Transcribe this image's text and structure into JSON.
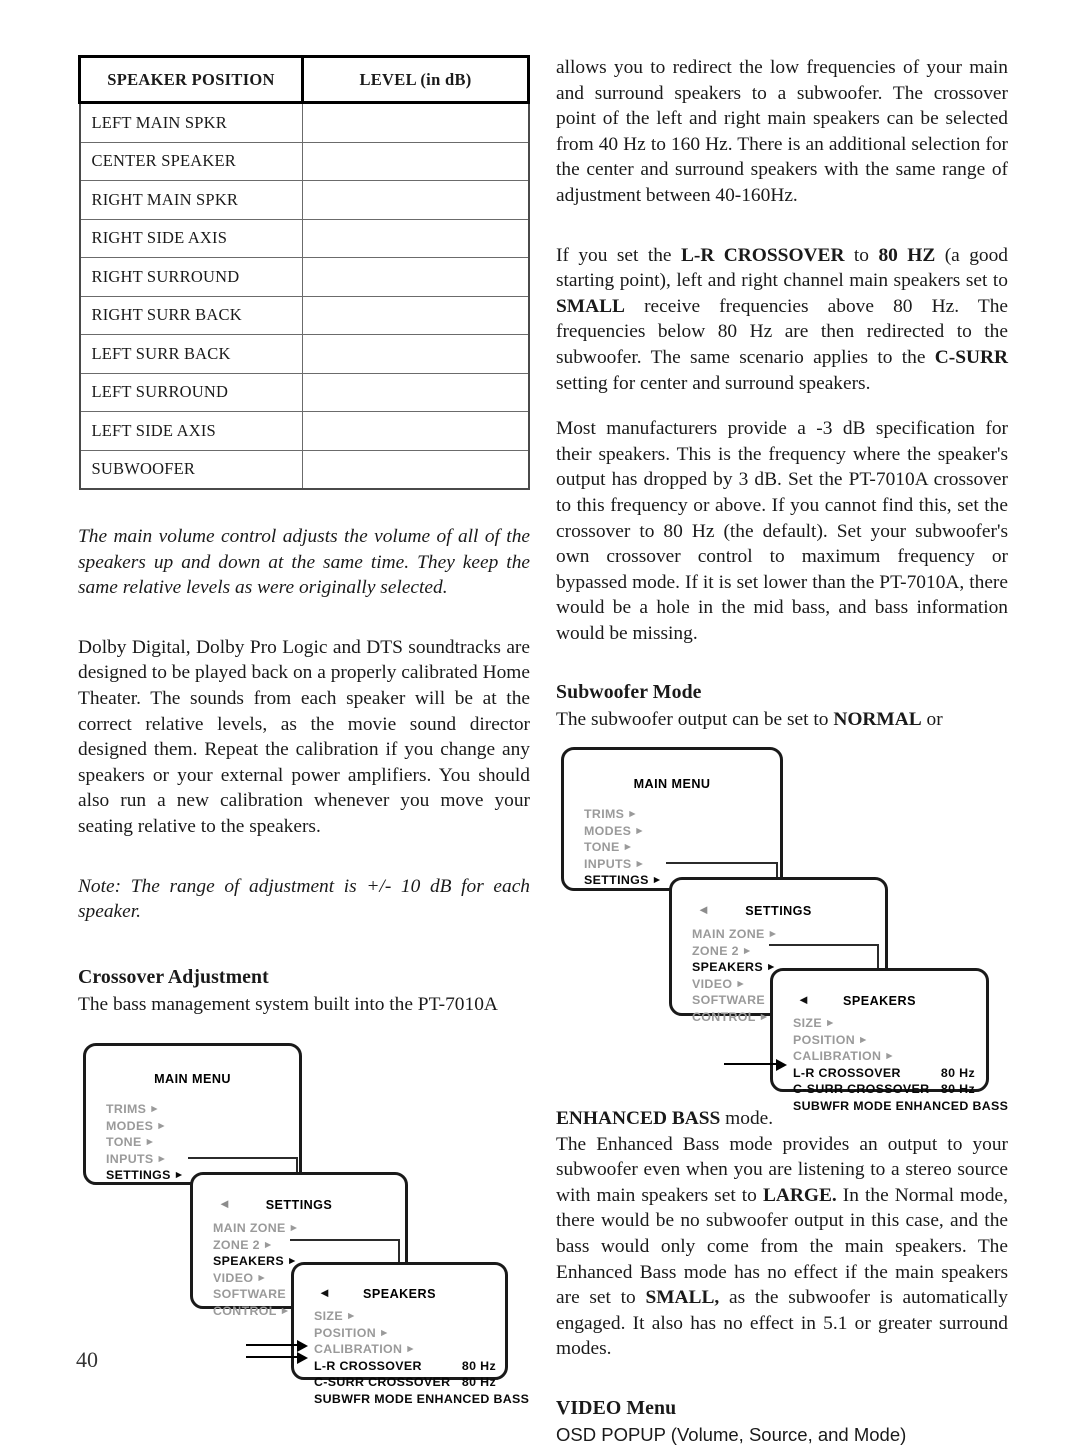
{
  "page": {
    "number": "40"
  },
  "table": {
    "headers": [
      "SPEAKER POSITION",
      "LEVEL (in dB)"
    ],
    "rows": [
      "LEFT MAIN SPKR",
      "CENTER SPEAKER",
      "RIGHT MAIN SPKR",
      "RIGHT SIDE AXIS",
      "RIGHT SURROUND",
      "RIGHT SURR BACK",
      "LEFT SURR BACK",
      "LEFT SURROUND",
      "LEFT SIDE AXIS",
      "SUBWOOFER"
    ],
    "values": [
      "",
      "",
      "",
      "",
      "",
      "",
      "",
      "",
      "",
      ""
    ]
  },
  "left_column": {
    "note_volume": "The main volume control adjusts the volume of all of the speakers up and down at the same time. They keep the same relative levels as were originally selected.",
    "calibration_paragraph": "Dolby Digital, Dolby Pro Logic and DTS soundtracks are designed to be played back on a properly calibrated Home Theater. The sounds from each speaker will be at the correct relative levels, as the movie sound director designed them. Repeat the calibration if you change any speakers or your external power amplifiers. You should also run a new calibration whenever you move your seating relative to the speakers.",
    "note_range": "Note: The range of adjustment is +/- 10 dB for each speaker.",
    "crossover_heading": "Crossover Adjustment",
    "crossover_intro": "The bass management system built into the PT-7010A"
  },
  "right_column": {
    "intro_paragraph": "allows you to redirect the low frequencies of your main and surround speakers to a subwoofer. The crossover point of the left and right main speakers can be selected from 40 Hz to 160 Hz. There is an additional selection for the center and surround speakers with the same range of adjustment between 40-160Hz.",
    "para2_pre": "If you set the ",
    "para2_b1": "L-R CROSSOVER",
    "para2_mid1": " to ",
    "para2_b2": "80 HZ",
    "para2_mid2": " (a good starting point), left and right channel main speakers set to ",
    "para2_b3": "SMALL",
    "para2_mid3": " receive frequencies above 80 Hz. The frequencies below 80 Hz are then redirected to the subwoofer. The same scenario applies to the ",
    "para2_b4": "C-SURR",
    "para2_end": " setting for center and surround speakers.",
    "para3": "Most manufacturers provide a -3 dB specification for their speakers. This is the frequency where the speaker's output has dropped by 3 dB. Set the PT-7010A crossover to this frequency or above. If you cannot find this, set the crossover to 80 Hz (the default). Set your subwoofer's own crossover control to maximum frequency or bypassed mode. If it is set lower than the PT-7010A, there would be a hole in the mid bass, and bass information would be missing.",
    "subwoofer_heading": "Subwoofer Mode",
    "subwoofer_intro_pre": "The subwoofer output can be set to ",
    "subwoofer_intro_b": "NORMAL",
    "subwoofer_intro_post": " or",
    "enhanced_b": "ENHANCED BASS",
    "enhanced_post": " mode.",
    "enhanced_para_pre": "The Enhanced Bass mode provides an output to your subwoofer even when you are listening to a stereo source with main speakers set to ",
    "enhanced_para_b1": "LARGE.",
    "enhanced_para_mid": " In the Normal mode, there would be no subwoofer output in this case, and the bass would only come from the main speakers. The Enhanced Bass mode has no effect if the main speakers are set to ",
    "enhanced_para_b2": "SMALL,",
    "enhanced_para_end": " as the subwoofer is automatically engaged. It also has no effect in 5.1 or greater surround modes.",
    "video_heading": "VIDEO Menu",
    "video_line": "OSD POPUP (Volume, Source, and Mode)"
  },
  "osd_left": {
    "main_menu": {
      "title": "MAIN MENU",
      "items": [
        {
          "label": "TRIMS",
          "selected": false,
          "arrow": "►"
        },
        {
          "label": "MODES",
          "selected": false,
          "arrow": "►"
        },
        {
          "label": "TONE",
          "selected": false,
          "arrow": "►"
        },
        {
          "label": "INPUTS",
          "selected": false,
          "arrow": "►"
        },
        {
          "label": "SETTINGS",
          "selected": true,
          "arrow": "►"
        }
      ]
    },
    "settings": {
      "title": "SETTINGS",
      "back": "◄",
      "items": [
        {
          "label": "MAIN ZONE",
          "selected": false,
          "arrow": "►"
        },
        {
          "label": "ZONE 2",
          "selected": false,
          "arrow": "►"
        },
        {
          "label": "SPEAKERS",
          "selected": true,
          "arrow": "►"
        },
        {
          "label": "VIDEO",
          "selected": false,
          "arrow": "►"
        },
        {
          "label": "SOFTWARE",
          "selected": false,
          "arrow": "►"
        },
        {
          "label": "CONTROL",
          "selected": false,
          "arrow": "►"
        }
      ]
    },
    "speakers": {
      "title": "SPEAKERS",
      "back": "◄",
      "items": [
        {
          "label": "SIZE",
          "selected": false,
          "arrow": "►",
          "value": ""
        },
        {
          "label": "POSITION",
          "selected": false,
          "arrow": "►",
          "value": ""
        },
        {
          "label": "CALIBRATION",
          "selected": false,
          "arrow": "►",
          "value": ""
        },
        {
          "label": "L-R CROSSOVER",
          "selected": true,
          "arrow": "",
          "value": "80 Hz"
        },
        {
          "label": "C-SURR CROSSOVER",
          "selected": true,
          "arrow": "",
          "value": "80 Hz"
        },
        {
          "label": "SUBWFR MODE  ENHANCED BASS",
          "selected": true,
          "arrow": "",
          "value": ""
        }
      ]
    }
  },
  "osd_right": {
    "main_menu": {
      "title": "MAIN MENU",
      "items": [
        {
          "label": "TRIMS",
          "selected": false,
          "arrow": "►"
        },
        {
          "label": "MODES",
          "selected": false,
          "arrow": "►"
        },
        {
          "label": "TONE",
          "selected": false,
          "arrow": "►"
        },
        {
          "label": "INPUTS",
          "selected": false,
          "arrow": "►"
        },
        {
          "label": "SETTINGS",
          "selected": true,
          "arrow": "►"
        }
      ]
    },
    "settings": {
      "title": "SETTINGS",
      "back": "◄",
      "items": [
        {
          "label": "MAIN ZONE",
          "selected": false,
          "arrow": "►"
        },
        {
          "label": "ZONE 2",
          "selected": false,
          "arrow": "►"
        },
        {
          "label": "SPEAKERS",
          "selected": true,
          "arrow": "►"
        },
        {
          "label": "VIDEO",
          "selected": false,
          "arrow": "►"
        },
        {
          "label": "SOFTWARE",
          "selected": false,
          "arrow": "►"
        },
        {
          "label": "CONTROL",
          "selected": false,
          "arrow": "►"
        }
      ]
    },
    "speakers": {
      "title": "SPEAKERS",
      "back": "◄",
      "items": [
        {
          "label": "SIZE",
          "selected": false,
          "arrow": "►",
          "value": ""
        },
        {
          "label": "POSITION",
          "selected": false,
          "arrow": "►",
          "value": ""
        },
        {
          "label": "CALIBRATION",
          "selected": false,
          "arrow": "►",
          "value": ""
        },
        {
          "label": "L-R CROSSOVER",
          "selected": true,
          "arrow": "",
          "value": "80 Hz"
        },
        {
          "label": "C-SURR CROSSOVER",
          "selected": true,
          "arrow": "",
          "value": "80 Hz"
        },
        {
          "label": "SUBWFR MODE  ENHANCED BASS",
          "selected": true,
          "arrow": "",
          "value": ""
        }
      ]
    }
  }
}
